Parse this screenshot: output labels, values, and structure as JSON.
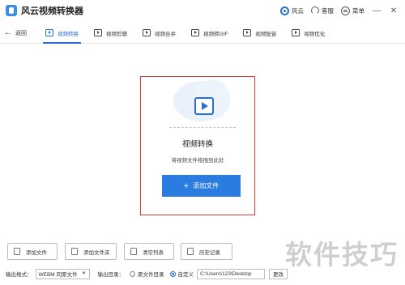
{
  "app": {
    "title": "风云视频转换器"
  },
  "titlebar": {
    "fengyun": "风云",
    "service": "客服",
    "menu": "菜单",
    "minimize": "—",
    "close": "✕"
  },
  "toolbar": {
    "back": "返回",
    "tabs": [
      {
        "label": "视频转换",
        "active": true
      },
      {
        "label": "视频剪辑",
        "active": false
      },
      {
        "label": "视频合并",
        "active": false
      },
      {
        "label": "视频转GIF",
        "active": false
      },
      {
        "label": "视频配音",
        "active": false
      },
      {
        "label": "视频优化",
        "active": false
      }
    ]
  },
  "dropzone": {
    "title": "视频转换",
    "subtitle": "将视频文件拖拽到此处",
    "add_button": "添加文件"
  },
  "actions": {
    "add_file": "添加文件",
    "add_folder": "添加文件夹",
    "clear_list": "清空列表",
    "history": "历史记录"
  },
  "output": {
    "format_label": "输出格式：",
    "format_value": "WEBM 同原文件",
    "dir_label": "输出目录：",
    "same_dir": "原文件目录",
    "custom": "自定义",
    "path": "C:\\Users\\123\\Desktop",
    "change": "更改"
  },
  "watermark": "软件技巧",
  "colors": {
    "accent": "#2b7ce0",
    "highlight_border": "#d93a3a"
  }
}
